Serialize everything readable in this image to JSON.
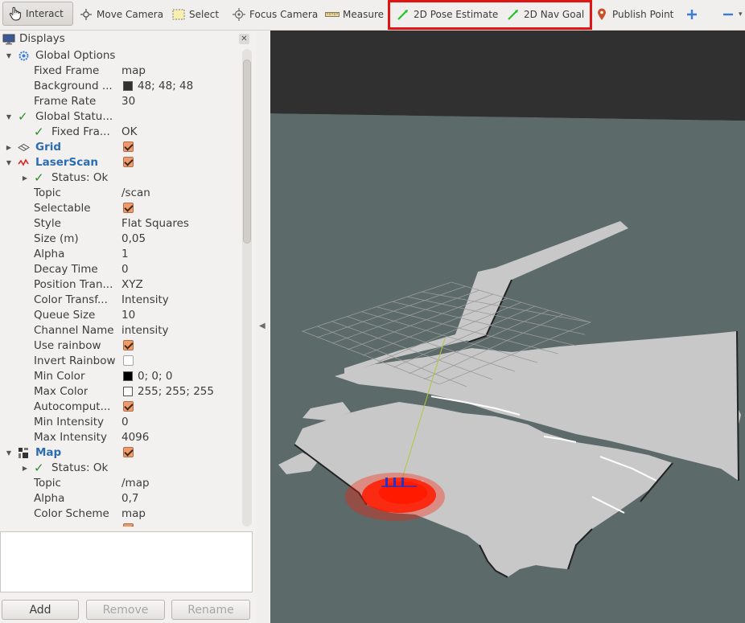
{
  "toolbar": {
    "interact": "Interact",
    "move_camera": "Move Camera",
    "select": "Select",
    "focus_camera": "Focus Camera",
    "measure": "Measure",
    "pose_estimate": "2D Pose Estimate",
    "nav_goal": "2D Nav Goal",
    "publish_point": "Publish Point"
  },
  "displays": {
    "title": "Displays",
    "rows": [
      {
        "label": "Global Options",
        "value": ""
      },
      {
        "label": "Fixed Frame",
        "value": "map"
      },
      {
        "label": "Background ...",
        "value": "48; 48; 48"
      },
      {
        "label": "Frame Rate",
        "value": "30"
      },
      {
        "label": "Global Statu...",
        "value": ""
      },
      {
        "label": "Fixed Fra...",
        "value": "OK"
      },
      {
        "label": "Grid",
        "value": ""
      },
      {
        "label": "LaserScan",
        "value": ""
      },
      {
        "label": "Status: Ok",
        "value": ""
      },
      {
        "label": "Topic",
        "value": "/scan"
      },
      {
        "label": "Selectable",
        "value": ""
      },
      {
        "label": "Style",
        "value": "Flat Squares"
      },
      {
        "label": "Size (m)",
        "value": "0,05"
      },
      {
        "label": "Alpha",
        "value": "1"
      },
      {
        "label": "Decay Time",
        "value": "0"
      },
      {
        "label": "Position Tran...",
        "value": "XYZ"
      },
      {
        "label": "Color Transf...",
        "value": "Intensity"
      },
      {
        "label": "Queue Size",
        "value": "10"
      },
      {
        "label": "Channel Name",
        "value": "intensity"
      },
      {
        "label": "Use rainbow",
        "value": ""
      },
      {
        "label": "Invert Rainbow",
        "value": ""
      },
      {
        "label": "Min Color",
        "value": "0; 0; 0"
      },
      {
        "label": "Max Color",
        "value": "255; 255; 255"
      },
      {
        "label": "Autocomput...",
        "value": ""
      },
      {
        "label": "Min Intensity",
        "value": "0"
      },
      {
        "label": "Max Intensity",
        "value": "4096"
      },
      {
        "label": "Map",
        "value": ""
      },
      {
        "label": "Status: Ok",
        "value": ""
      },
      {
        "label": "Topic",
        "value": "/map"
      },
      {
        "label": "Alpha",
        "value": "0,7"
      },
      {
        "label": "Color Scheme",
        "value": "map"
      }
    ]
  },
  "buttons": {
    "add": "Add",
    "remove": "Remove",
    "rename": "Rename"
  },
  "colors": {
    "highlight": "#e11414",
    "accent_blue": "#2b6cb3",
    "checkbox": "#f09a6a",
    "laser": "#ff1a00",
    "background_3d": "#303030"
  }
}
